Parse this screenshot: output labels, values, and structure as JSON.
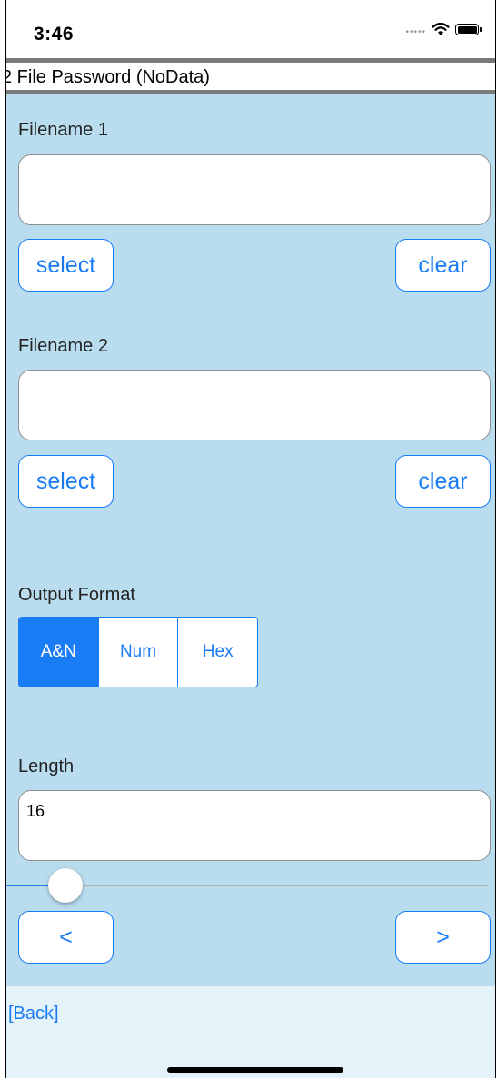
{
  "status_bar": {
    "time": "3:46",
    "signal_icon": "cellular-dots-icon",
    "wifi_icon": "wifi-icon",
    "battery_icon": "battery-icon"
  },
  "title": "2 File Password (NoData)",
  "file1": {
    "label": "Filename 1",
    "value": "",
    "select_label": "select",
    "clear_label": "clear"
  },
  "file2": {
    "label": "Filename 2",
    "value": "",
    "select_label": "select",
    "clear_label": "clear"
  },
  "output_format": {
    "label": "Output Format",
    "options": [
      "A&N",
      "Num",
      "Hex"
    ],
    "selected": "A&N"
  },
  "length": {
    "label": "Length",
    "value": "16",
    "slider_fraction": 0.06,
    "prev_label": "<",
    "next_label": ">"
  },
  "footer": {
    "back_label": "[Back]"
  },
  "colors": {
    "accent": "#1a7cf5",
    "background": "#b9ddee",
    "footer_background": "#e4f2f9"
  }
}
